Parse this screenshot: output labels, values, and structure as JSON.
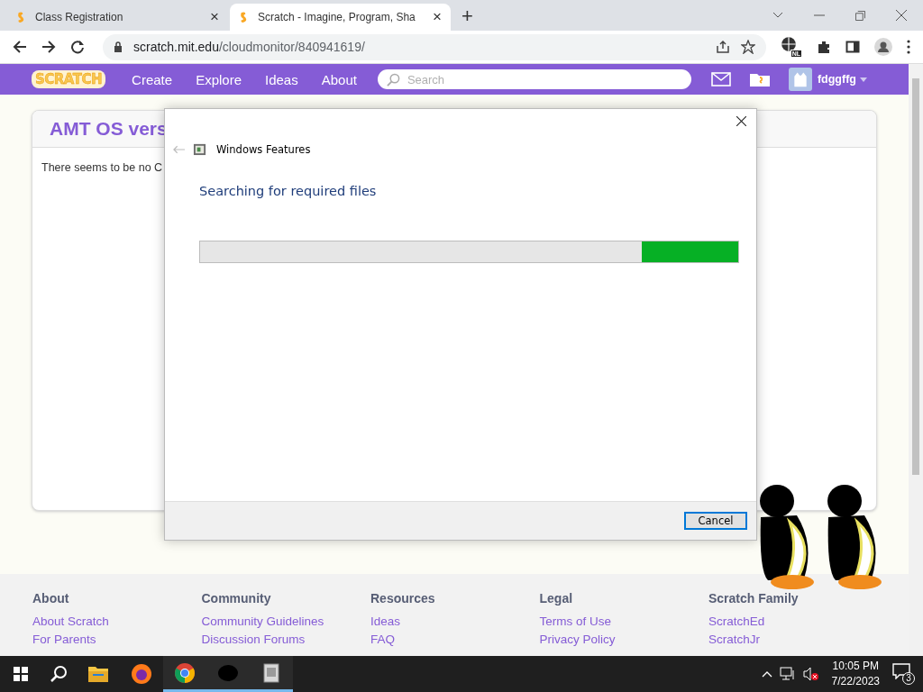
{
  "browser": {
    "tabs": [
      {
        "title": "Class Registration",
        "selected": false,
        "close": "×"
      },
      {
        "title": "Scratch - Imagine, Program, Sha",
        "selected": true,
        "close": "×"
      }
    ],
    "new_tab": "+",
    "url_host": "scratch.mit.edu",
    "url_path": "/cloudmonitor/840941619/",
    "extension_badge": "NL"
  },
  "nav": {
    "logo": "SCRATCH",
    "links": [
      "Create",
      "Explore",
      "Ideas",
      "About"
    ],
    "search": {
      "placeholder": "Search"
    },
    "username": "fdggffg"
  },
  "card": {
    "title": "AMT OS vers",
    "message": "There seems to be no C"
  },
  "dialog": {
    "title": "Windows Features",
    "heading": "Searching for required files",
    "level": 0.18,
    "button": "Cancel"
  },
  "footer": [
    {
      "heading": "About",
      "links": [
        "About Scratch",
        "For Parents"
      ]
    },
    {
      "heading": "Community",
      "links": [
        "Community Guidelines",
        "Discussion Forums"
      ]
    },
    {
      "heading": "Resources",
      "links": [
        "Ideas",
        "FAQ"
      ]
    },
    {
      "heading": "Legal",
      "links": [
        "Terms of Use",
        "Privacy Policy"
      ]
    },
    {
      "heading": "Scratch Family",
      "links": [
        "ScratchEd",
        "ScratchJr"
      ]
    }
  ],
  "taskbar": {
    "time": "10:05 PM",
    "date": "7/22/2023",
    "notifications": "3",
    "apps": [
      {
        "kind": "explorer",
        "running": false
      },
      {
        "kind": "firefox",
        "running": false
      },
      {
        "kind": "chrome",
        "running": true
      },
      {
        "kind": "figure",
        "running": true
      },
      {
        "kind": "installer",
        "running": true
      }
    ]
  }
}
